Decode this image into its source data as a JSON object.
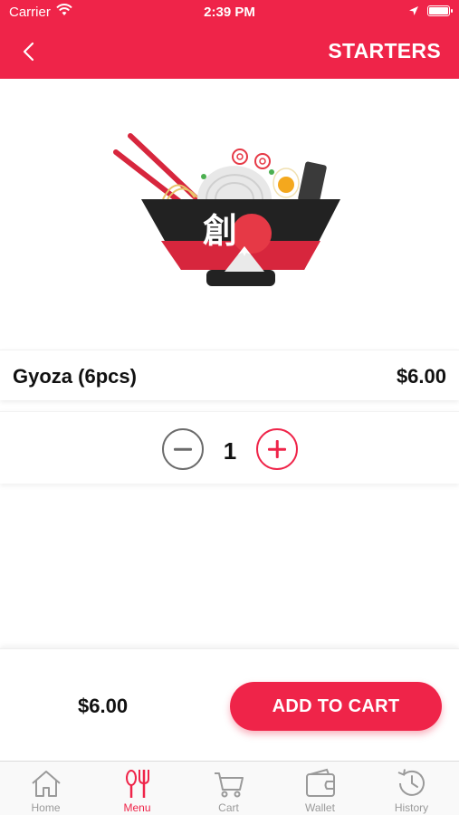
{
  "status_bar": {
    "carrier": "Carrier",
    "time": "2:39 PM"
  },
  "header": {
    "title": "STARTERS",
    "back_icon": "chevron-left-icon"
  },
  "item": {
    "name": "Gyoza (6pcs)",
    "price": "$6.00",
    "image_logo_text": "創"
  },
  "quantity": {
    "value": "1",
    "decrement_icon": "minus-circle-icon",
    "increment_icon": "plus-circle-icon"
  },
  "footer": {
    "total": "$6.00",
    "add_to_cart_label": "ADD TO CART"
  },
  "tabbar": {
    "tabs": [
      {
        "label": "Home",
        "icon": "home-icon",
        "active": false
      },
      {
        "label": "Menu",
        "icon": "fork-knife-icon",
        "active": true
      },
      {
        "label": "Cart",
        "icon": "cart-icon",
        "active": false
      },
      {
        "label": "Wallet",
        "icon": "wallet-icon",
        "active": false
      },
      {
        "label": "History",
        "icon": "history-icon",
        "active": false
      }
    ]
  },
  "colors": {
    "brand": "#ef2449",
    "tab_inactive": "#9a9a9a",
    "text": "#111111"
  }
}
